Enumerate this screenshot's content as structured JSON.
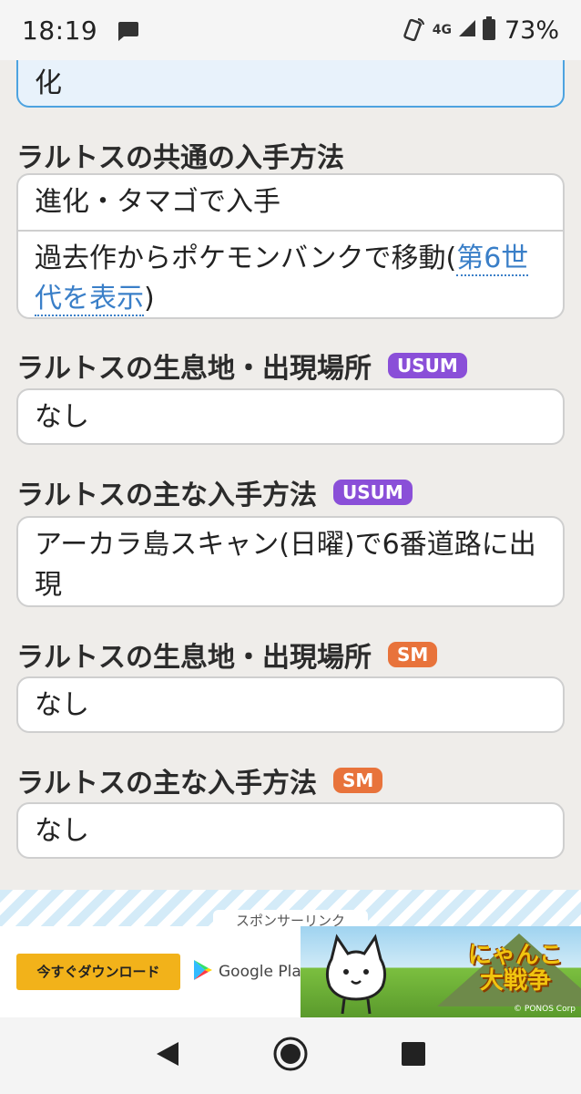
{
  "status": {
    "time": "18:19",
    "network": "4G",
    "battery": "73%"
  },
  "top_box": {
    "text": "化"
  },
  "sections": [
    {
      "heading": "ラルトスの共通の入手方法",
      "tag": "",
      "rows": [
        "進化・タマゴで入手"
      ]
    },
    {
      "heading": "ラルトスの生息地・出現場所",
      "tag": "USUM",
      "rows": [
        "なし"
      ]
    },
    {
      "heading": "ラルトスの主な入手方法",
      "tag": "USUM",
      "rows": [
        "アーカラ島スキャン(日曜)で6番道路に出現"
      ]
    },
    {
      "heading": "ラルトスの生息地・出現場所",
      "tag": "SM",
      "rows": [
        "なし"
      ]
    },
    {
      "heading": "ラルトスの主な入手方法",
      "tag": "SM",
      "rows": [
        "なし"
      ]
    }
  ],
  "common_row2": {
    "prefix": "過去作からポケモンバンクで移動(",
    "link": "第6世代を表示",
    "suffix": ")"
  },
  "ad": {
    "sponsor": "スポンサーリンク",
    "button": "今すぐダウンロード",
    "store": "Google Play",
    "title_line1": "にゃんこ",
    "title_line2": "大戦争",
    "copyright": "© PONOS Corp"
  },
  "colors": {
    "usum_tag": "#8a4fd8",
    "sm_tag": "#e8733b",
    "link": "#3a7fc8"
  }
}
